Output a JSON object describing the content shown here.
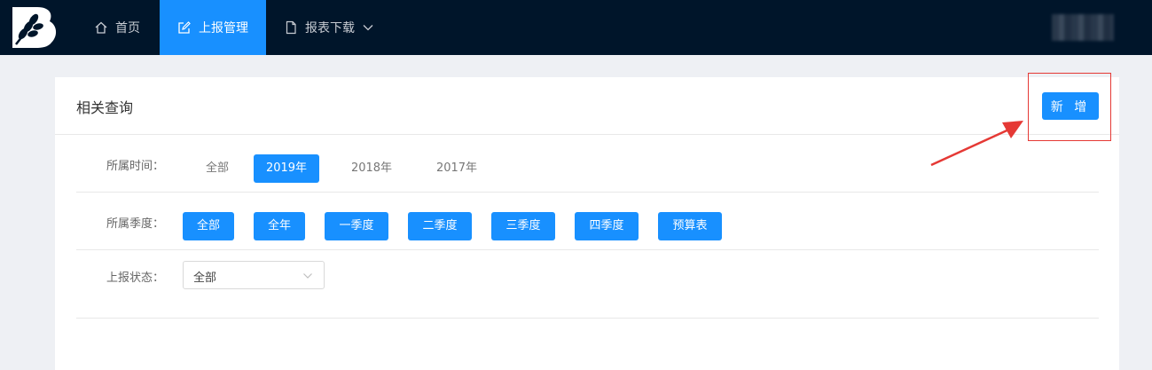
{
  "nav": {
    "items": [
      {
        "label": "首页",
        "icon": "home-icon"
      },
      {
        "label": "上报管理",
        "icon": "edit-icon",
        "active": true
      },
      {
        "label": "报表下载",
        "icon": "document-icon"
      }
    ]
  },
  "panel": {
    "title": "相关查询",
    "add_button": "新 增"
  },
  "filters": {
    "time": {
      "label": "所属时间：",
      "options": [
        "全部",
        "2019年",
        "2018年",
        "2017年"
      ],
      "selected": "2019年"
    },
    "quarter": {
      "label": "所属季度：",
      "options": [
        "全部",
        "全年",
        "一季度",
        "二季度",
        "三季度",
        "四季度",
        "预算表"
      ]
    },
    "status": {
      "label": "上报状态：",
      "value": "全部"
    }
  },
  "colors": {
    "nav_bg": "#00152a",
    "accent": "#1890ff",
    "annotation": "#e53935"
  }
}
